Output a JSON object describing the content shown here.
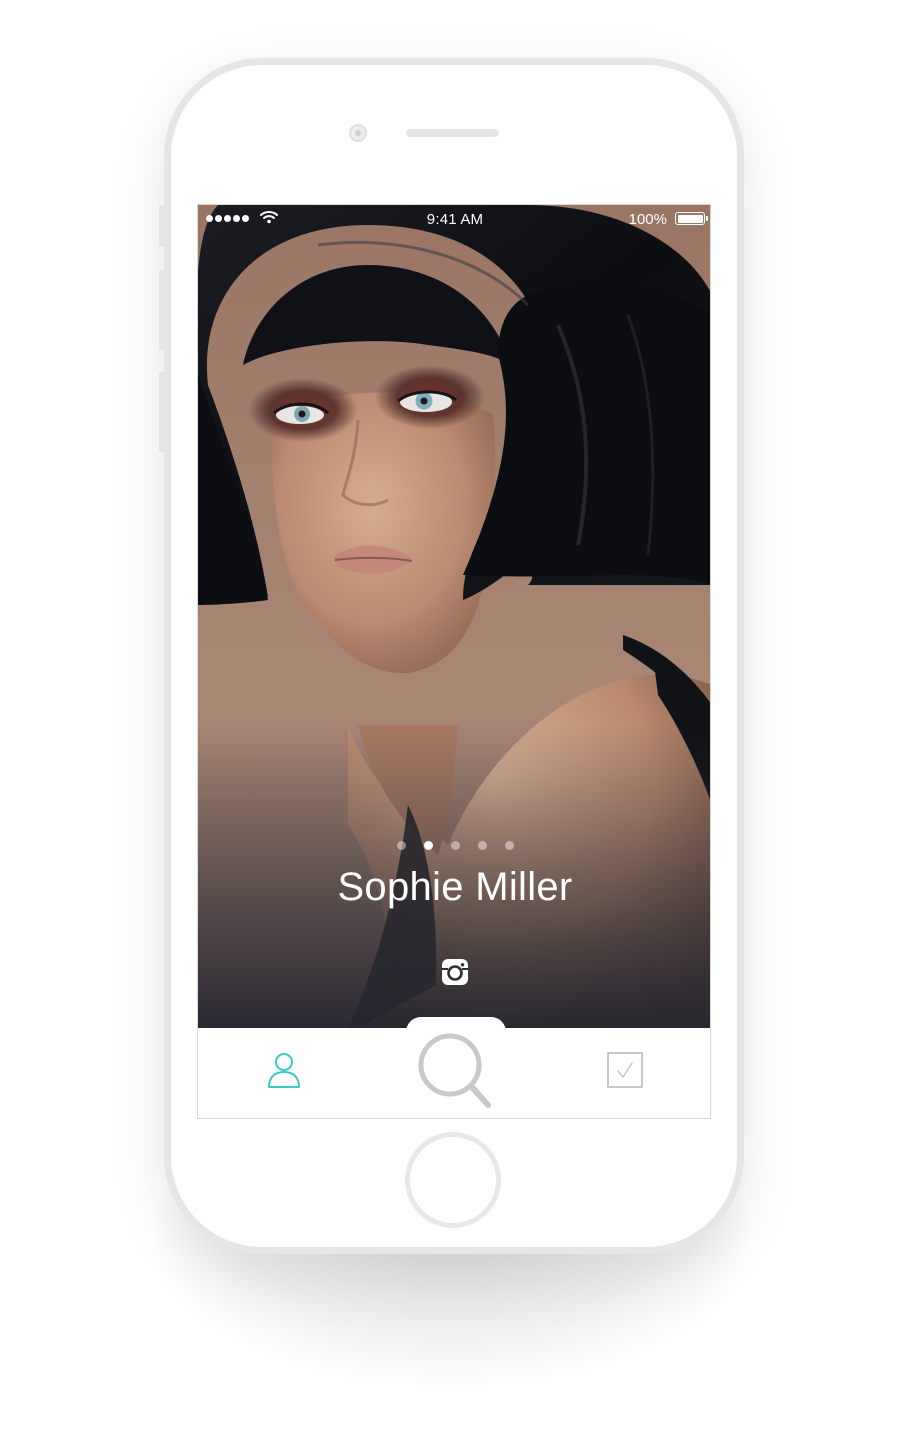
{
  "status_bar": {
    "time": "9:41 AM",
    "battery": "100%",
    "signal_icon": "signal-dots-icon",
    "wifi_icon": "wifi-icon",
    "battery_icon": "battery-icon"
  },
  "profile": {
    "name": "Sophie Miller",
    "social_icon": "instagram-icon"
  },
  "carousel": {
    "total_pages": 5,
    "active_index": 1
  },
  "tab_bar": {
    "items": [
      {
        "icon": "profile-icon",
        "active": true
      },
      {
        "icon": "search-icon",
        "active": false
      },
      {
        "icon": "checkbox-icon",
        "active": false
      }
    ]
  },
  "colors": {
    "accent": "#3dc9c6",
    "tab_inactive": "#c8c8c8",
    "phone_frame": "#e6e6e6"
  }
}
